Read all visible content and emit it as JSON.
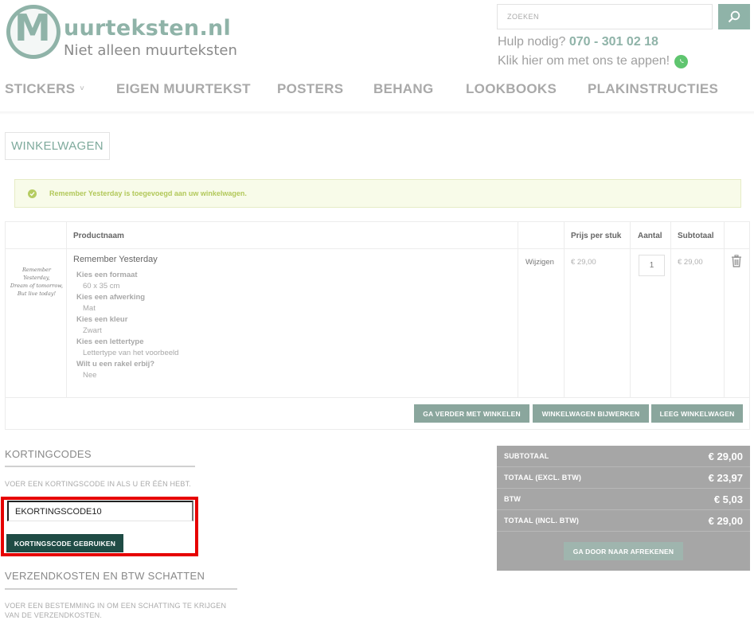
{
  "brand": {
    "logo_letter": "M",
    "name": "uurteksten.nl",
    "tagline": "Niet alleen muurteksten"
  },
  "search": {
    "placeholder": "ZOEKEN",
    "icon": "search-icon"
  },
  "help": {
    "prefix": "Hulp nodig?",
    "phone": "070 - 301 02 18",
    "app_text": "Klik hier om met ons te appen!",
    "app_icon": "whatsapp-icon"
  },
  "nav": {
    "items": [
      {
        "label": "STICKERS",
        "has_dropdown": true
      },
      {
        "label": "EIGEN MUURTEKST"
      },
      {
        "label": "POSTERS"
      },
      {
        "label": "BEHANG"
      },
      {
        "label": "LOOKBOOKS"
      },
      {
        "label": "PLAKINSTRUCTIES"
      }
    ],
    "dropdown_glyph": "˅"
  },
  "page_title": "WINKELWAGEN",
  "notice": {
    "text": "Remember Yesterday is toegevoegd aan uw winkelwagen."
  },
  "cart": {
    "headers": {
      "product": "Productnaam",
      "price": "Prijs per stuk",
      "qty": "Aantal",
      "subtotal": "Subtotaal"
    },
    "item": {
      "thumb_lines": [
        "Remember Yesterday,",
        "Dream of tomorrow,",
        "But live today!"
      ],
      "name": "Remember Yesterday",
      "options": [
        {
          "label": "Kies een formaat",
          "value": "60 x 35 cm"
        },
        {
          "label": "Kies een afwerking",
          "value": "Mat"
        },
        {
          "label": "Kies een kleur",
          "value": "Zwart"
        },
        {
          "label": "Kies een lettertype",
          "value": "Lettertype van het voorbeeld"
        },
        {
          "label": "Wilt u een rakel erbij?",
          "value": "Nee"
        }
      ],
      "edit_label": "Wijzigen",
      "unit_price": "€ 29,00",
      "quantity": "1",
      "subtotal": "€ 29,00"
    },
    "buttons": {
      "continue": "GA VERDER MET WINKELEN",
      "update": "WINKELWAGEN BIJWERKEN",
      "clear": "LEEG WINKELWAGEN"
    }
  },
  "discount": {
    "title": "KORTINGCODES",
    "description": "VOER EEN KORTINGSCODE IN ALS U ER ÉÉN HEBT.",
    "input_value": "EKORTINGSCODE10",
    "button": "KORTINGSCODE GEBRUIKEN",
    "highlight_color": "#e60000"
  },
  "shipping": {
    "title": "VERZENDKOSTEN EN BTW SCHATTEN",
    "description_line1": "VOER EEN BESTEMMING IN OM EEN SCHATTING TE KRIJGEN",
    "description_line2": "VAN DE VERZENDKOSTEN."
  },
  "totals": {
    "rows": [
      {
        "label": "SUBTOTAAL",
        "value": "€ 29,00"
      },
      {
        "label": "TOTAAL (EXCL. BTW)",
        "value": "€ 23,97"
      },
      {
        "label": "BTW",
        "value": "€ 5,03"
      },
      {
        "label": "TOTAAL (INCL. BTW)",
        "value": "€ 29,00"
      }
    ],
    "checkout": "GA DOOR NAAR AFREKENEN"
  },
  "colors": {
    "accent": "#8fb3a8",
    "dark_button": "#1f4c45",
    "totals_bg": "#a6a6a6",
    "notice_text": "#b2c85a"
  }
}
